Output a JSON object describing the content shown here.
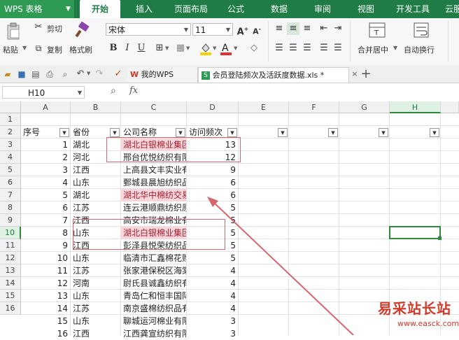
{
  "app": {
    "logo": "WPS 表格"
  },
  "menu": {
    "tabs": [
      "开始",
      "插入",
      "页面布局",
      "公式",
      "数据",
      "审阅",
      "视图",
      "开发工具",
      "云服"
    ],
    "active": "开始"
  },
  "ribbon": {
    "paste": "粘贴",
    "cut": "剪切",
    "copy": "复制",
    "format_painter": "格式刷",
    "font_name": "宋体",
    "font_size": "11",
    "merge_center": "合并居中",
    "wrap_text": "自动换行"
  },
  "doc_tabs": {
    "my_wps": "我的WPS",
    "file": "会员登陆频次及活跃度数据.xls *",
    "new_tab": "+"
  },
  "formula_bar": {
    "name_box": "H10",
    "fx": "fx",
    "value": ""
  },
  "sheet": {
    "columns": [
      "A",
      "B",
      "C",
      "D",
      "E",
      "F",
      "G",
      "H"
    ],
    "selected_column": "H",
    "selected_row": 10,
    "row_numbers": [
      "1",
      "2",
      "3",
      "4",
      "5",
      "6",
      "7",
      "8",
      "9",
      "10",
      "11",
      "12",
      "13",
      "14",
      "15",
      "16"
    ],
    "headers": [
      "序号",
      "省份",
      "公司名称",
      "访问频次"
    ],
    "rows": [
      {
        "id": "1",
        "province": "湖北",
        "company": "湖北白银棉业集团",
        "visits": "13",
        "hl": true
      },
      {
        "id": "2",
        "province": "河北",
        "company": "邢台优悦纺织有限",
        "visits": "12",
        "hl": false
      },
      {
        "id": "3",
        "province": "江西",
        "company": "上高县文丰实业有",
        "visits": "9",
        "hl": false
      },
      {
        "id": "4",
        "province": "山东",
        "company": "鄄城县晨旭纺织品",
        "visits": "6",
        "hl": false
      },
      {
        "id": "5",
        "province": "湖北",
        "company": "湖北华中棉纺交易",
        "visits": "6",
        "hl": true
      },
      {
        "id": "6",
        "province": "江苏",
        "company": "连云港顺鼎纺织原",
        "visits": "5",
        "hl": false
      },
      {
        "id": "7",
        "province": "江西",
        "company": "高安市瑞龙棉业有",
        "visits": "5",
        "hl": false
      },
      {
        "id": "8",
        "province": "山东",
        "company": "湖北白银棉业集团",
        "visits": "5",
        "hl": true
      },
      {
        "id": "9",
        "province": "江西",
        "company": "彭泽县悦荣纺织品",
        "visits": "5",
        "hl": false
      },
      {
        "id": "10",
        "province": "山东",
        "company": "临清市汇鑫棉花购",
        "visits": "5",
        "hl": false
      },
      {
        "id": "11",
        "province": "江苏",
        "company": "张家港保税区海棠",
        "visits": "4",
        "hl": false
      },
      {
        "id": "12",
        "province": "河南",
        "company": "尉氏县诚鑫纺织有",
        "visits": "4",
        "hl": false
      },
      {
        "id": "13",
        "province": "山东",
        "company": "青岛仁和恒丰国际",
        "visits": "4",
        "hl": false
      },
      {
        "id": "14",
        "province": "江苏",
        "company": "南京盛棉纺织品有",
        "visits": "4",
        "hl": false
      },
      {
        "id": "15",
        "province": "山东",
        "company": "聊城运河棉业有限",
        "visits": "3",
        "hl": false
      },
      {
        "id": "16",
        "province": "江西",
        "company": "江西龚宣纺织有限",
        "visits": "3",
        "hl": false
      }
    ]
  },
  "watermark": {
    "text": "易采站长站",
    "url": "www.easck.com"
  },
  "colors": {
    "accent": "#1f7c46",
    "highlight_fill": "#f9d6dc",
    "annotation": "#d8666d"
  }
}
